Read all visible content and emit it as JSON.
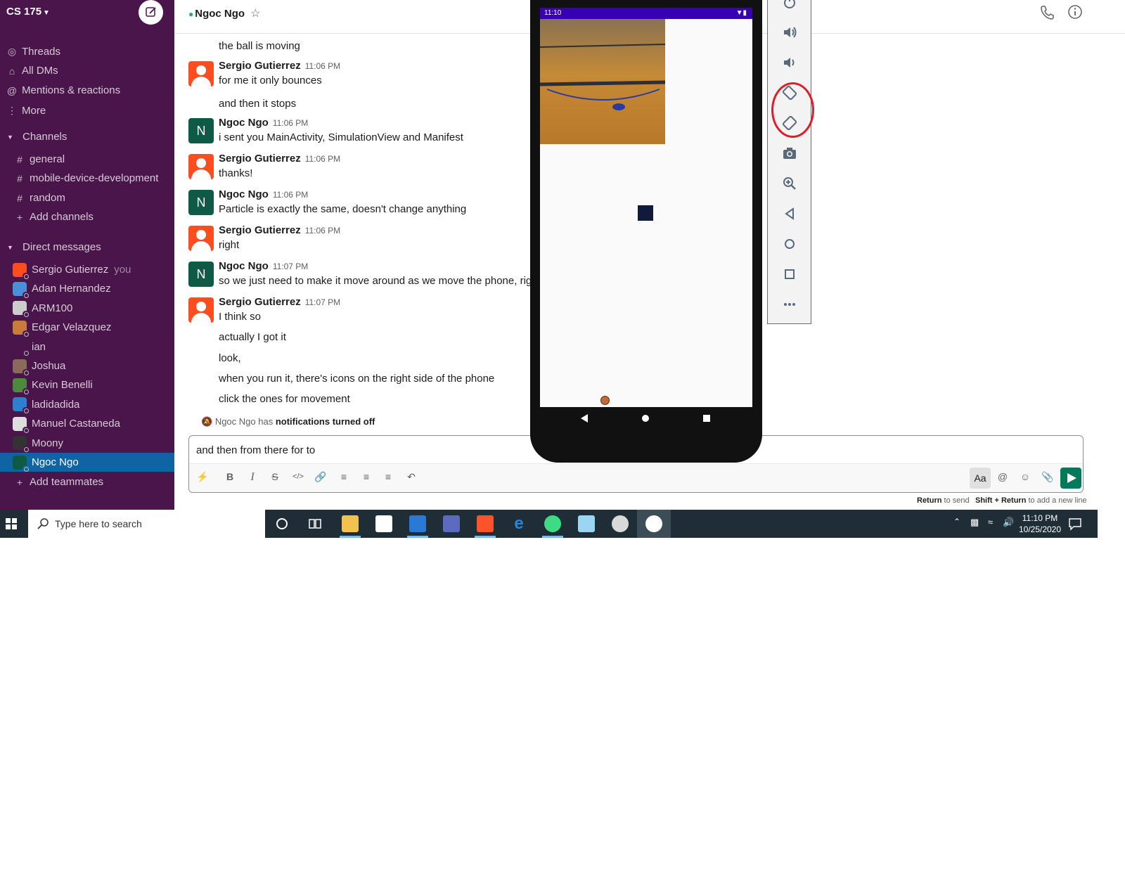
{
  "sidebar": {
    "workspace": "CS 175",
    "nav": [
      {
        "label": "Threads",
        "icon": "threads-icon"
      },
      {
        "label": "All DMs",
        "icon": "dms-icon"
      },
      {
        "label": "Mentions & reactions",
        "icon": "at-icon"
      },
      {
        "label": "More",
        "icon": "more-vertical-icon"
      }
    ],
    "channels_heading": "Channels",
    "channels": [
      "general",
      "mobile-device-development",
      "random"
    ],
    "add_channels": "Add channels",
    "dm_heading": "Direct messages",
    "dms": [
      {
        "name": "Sergio Gutierrez",
        "suffix": "you",
        "color": "#ff4d1f"
      },
      {
        "name": "Adan Hernandez",
        "suffix": "",
        "color": "#4a90d9"
      },
      {
        "name": "ARM100",
        "suffix": "",
        "color": "#cccccc"
      },
      {
        "name": "Edgar Velazquez",
        "suffix": "",
        "color": "#c97c3a"
      },
      {
        "name": "ian",
        "suffix": "",
        "color": "#4a154b"
      },
      {
        "name": "Joshua",
        "suffix": "",
        "color": "#8a6a5a"
      },
      {
        "name": "Kevin Benelli",
        "suffix": "",
        "color": "#4d8a3c"
      },
      {
        "name": "ladidadida",
        "suffix": "",
        "color": "#2d7fd1"
      },
      {
        "name": "Manuel Castaneda",
        "suffix": "",
        "color": "#dddddd"
      },
      {
        "name": "Moony",
        "suffix": "",
        "color": "#333333"
      },
      {
        "name": "Ngoc Ngo",
        "suffix": "",
        "color": "#0f5a47"
      }
    ],
    "add_teammates": "Add teammates"
  },
  "header": {
    "title": "Ngoc Ngo"
  },
  "messages": [
    {
      "type": "cont",
      "text": "the ball is moving"
    },
    {
      "type": "head",
      "author": "Sergio Gutierrez",
      "avatar": "sergio",
      "time": "11:06 PM",
      "text": "for me it only bounces"
    },
    {
      "type": "cont",
      "text": "and then it stops"
    },
    {
      "type": "head",
      "author": "Ngoc Ngo",
      "avatar": "ngoc",
      "initial": "N",
      "time": "11:06 PM",
      "text": "i sent you MainActivity, SimulationView and Manifest"
    },
    {
      "type": "head",
      "author": "Sergio Gutierrez",
      "avatar": "sergio",
      "time": "11:06 PM",
      "text": "thanks!"
    },
    {
      "type": "head",
      "author": "Ngoc Ngo",
      "avatar": "ngoc",
      "initial": "N",
      "time": "11:06 PM",
      "text": "Particle is exactly the same, doesn't change anything"
    },
    {
      "type": "head",
      "author": "Sergio Gutierrez",
      "avatar": "sergio",
      "time": "11:06 PM",
      "text": "right"
    },
    {
      "type": "head",
      "author": "Ngoc Ngo",
      "avatar": "ngoc",
      "initial": "N",
      "time": "11:07 PM",
      "text": "so we just need to make it move around as we move the phone, right"
    },
    {
      "type": "head",
      "author": "Sergio Gutierrez",
      "avatar": "sergio",
      "time": "11:07 PM",
      "text": "I think so"
    },
    {
      "type": "cont",
      "text": "actually I got it"
    },
    {
      "type": "cont",
      "text": "look,"
    },
    {
      "type": "cont",
      "text": "when you run it, there's icons on the right side of the phone"
    },
    {
      "type": "cont",
      "text": "click the ones for movement"
    }
  ],
  "notification": {
    "prefix": "Ngoc Ngo has ",
    "bold": "notifications turned off"
  },
  "composer": {
    "draft": "and then from there for to",
    "format_label": "Aa",
    "hint_send_key": "Return",
    "hint_send_text": " to send",
    "hint_newline_key": "Shift + Return",
    "hint_newline_text": " to add a new line"
  },
  "taskbar": {
    "search_placeholder": "Type here to search",
    "time": "11:10 PM",
    "date": "10/25/2020"
  },
  "phone": {
    "status_time": "11:10"
  }
}
